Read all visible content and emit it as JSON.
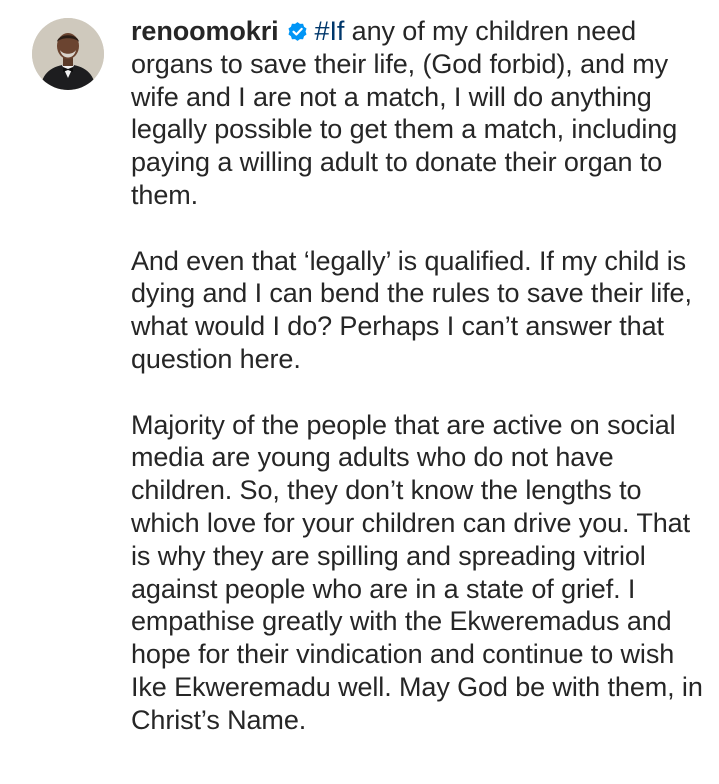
{
  "post": {
    "username": "renoomokri",
    "verified_icon": "verified-badge-icon",
    "hashtag": "#If",
    "paragraphs": [
      " any of my children need organs to save their life, (God forbid), and my wife and I are not a match, I will do anything legally possible to get them a match, including paying a willing adult to donate their organ to them.",
      "And even that ‘legally’ is qualified. If my child is dying and I can bend the rules to save their life, what would I do? Perhaps I can’t answer that question here.",
      "Majority of the people that are active on social media are young adults who do not have children. So, they don’t know the lengths to which love for your children can drive you. That is why they are spilling and spreading vitriol against people who are in a state of grief. I empathise greatly with the Ekweremadus and hope for their vindication and continue to wish Ike Ekweremadu well. May God be with them, in Christ’s Name."
    ],
    "colors": {
      "text": "#262626",
      "hashtag": "#00376b",
      "verified": "#0095f6"
    }
  }
}
